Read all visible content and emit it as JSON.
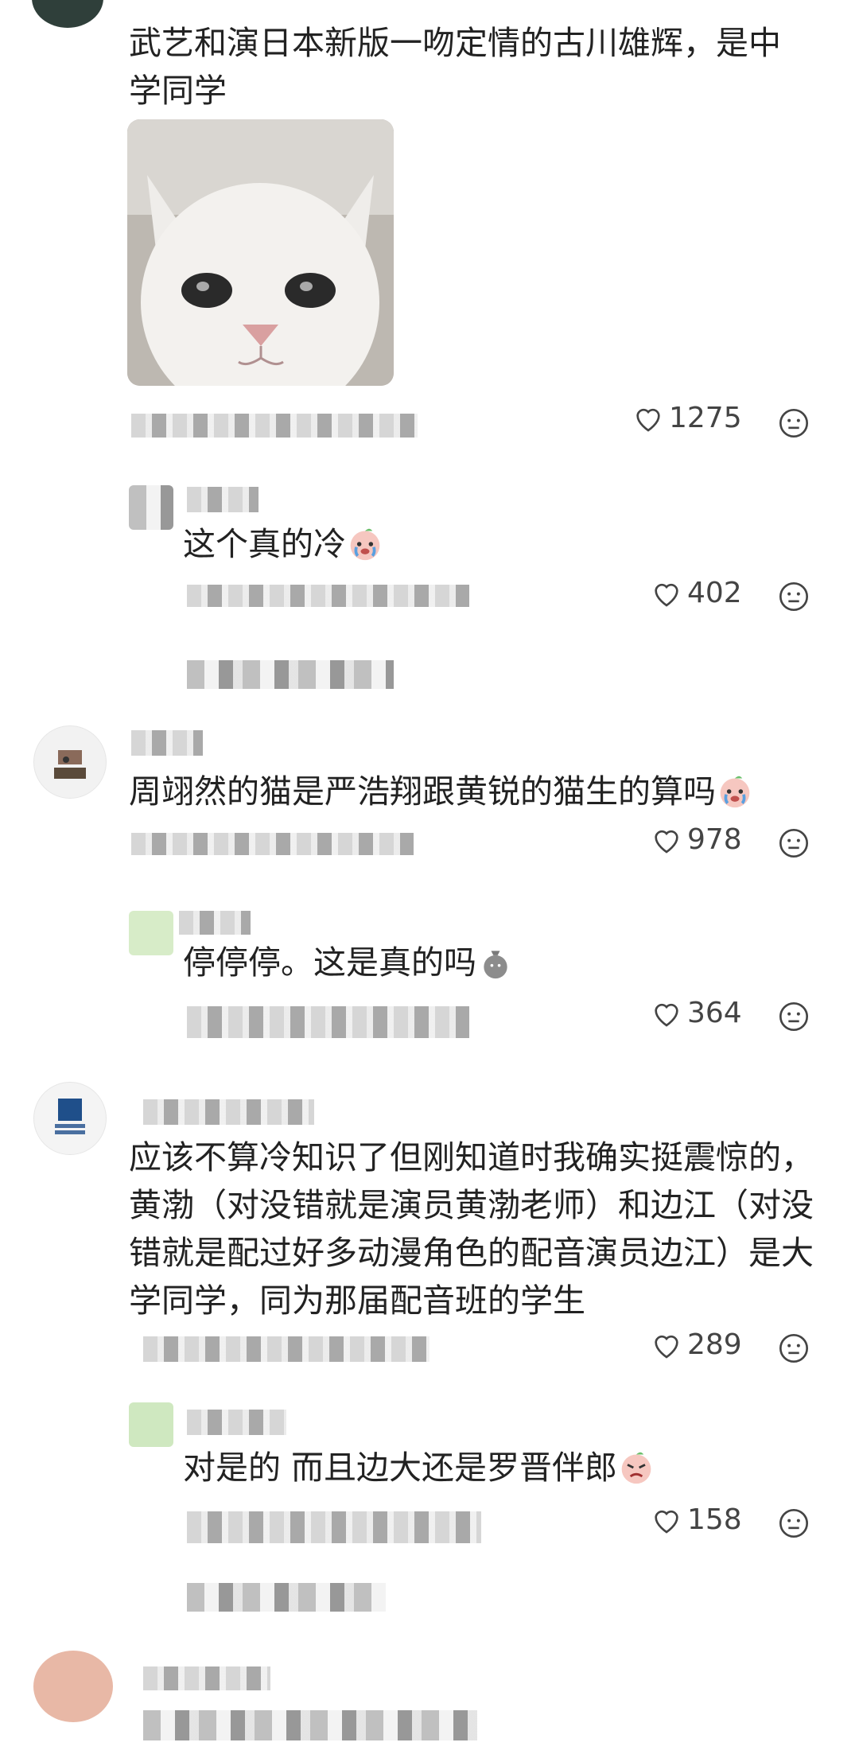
{
  "comments": [
    {
      "text": "武艺和演日本新版一吻定情的古川雄辉，是中学同学",
      "likes": "1275"
    },
    {
      "text": "这个真的冷",
      "likes": "402"
    },
    {
      "text": "周翊然的猫是严浩翔跟黄锐的猫生的算吗",
      "likes": "978"
    },
    {
      "text": "停停停。这是真的吗",
      "likes": "364"
    },
    {
      "text": "应该不算冷知识了但刚知道时我确实挺震惊的，黄渤（对没错就是演员黄渤老师）和边江（对没错就是配过好多动漫角色的配音演员边江）是大学同学，同为那届配音班的学生",
      "likes": "289"
    },
    {
      "text": "对是的 而且边大还是罗晋伴郎",
      "likes": "158"
    }
  ],
  "icons": {
    "like": "heart-outline-icon",
    "reaction": "neutral-face-icon"
  }
}
